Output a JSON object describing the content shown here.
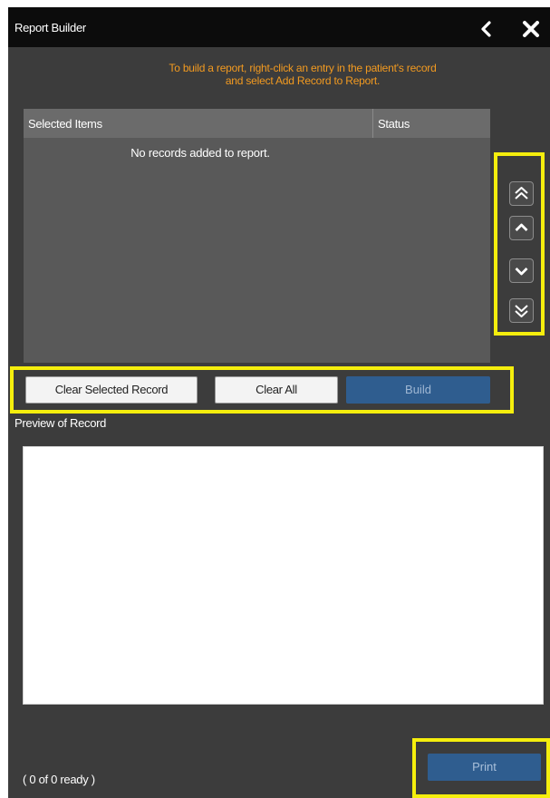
{
  "window": {
    "title": "Report Builder",
    "back_icon": "chevron-left-icon",
    "close_icon": "close-icon"
  },
  "instructions": {
    "line1": "To build a report, right-click an entry in the patient's record",
    "line2": "and select Add Record to Report."
  },
  "table": {
    "columns": [
      "Selected Items",
      "Status"
    ],
    "empty_message": "No records added to report.",
    "rows": []
  },
  "reorder": {
    "buttons": [
      {
        "name": "move-to-top",
        "icon": "double-chevron-up-icon"
      },
      {
        "name": "move-up",
        "icon": "chevron-up-icon"
      },
      {
        "name": "move-down",
        "icon": "chevron-down-icon"
      },
      {
        "name": "move-to-bottom",
        "icon": "double-chevron-down-icon"
      }
    ]
  },
  "actions": {
    "clear_selected": "Clear Selected Record",
    "clear_all": "Clear All",
    "build": "Build"
  },
  "preview": {
    "label": "Preview of Record",
    "content": ""
  },
  "footer": {
    "ready_status": "( 0 of 0 ready )",
    "print": "Print"
  },
  "colors": {
    "panel_bg": "#3c3c3c",
    "titlebar_bg": "#0c0c0c",
    "instruction_text": "#f29a20",
    "table_bg": "#595959",
    "table_header_bg": "#6b6b6b",
    "primary_button": "#2f5d8f",
    "highlight": "#f5ee0d"
  }
}
